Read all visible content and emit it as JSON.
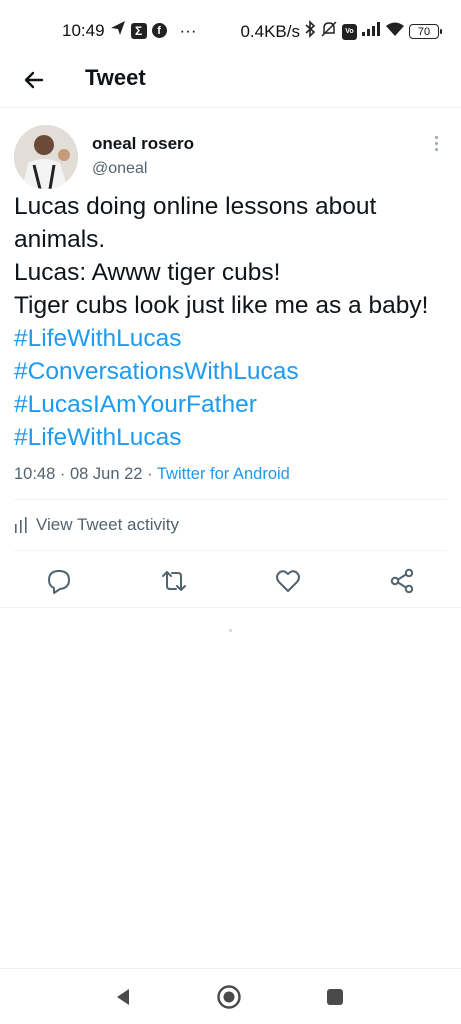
{
  "status_bar": {
    "time": "10:49",
    "left_icons": [
      "send-icon",
      "sigma-icon",
      "facebook-icon"
    ],
    "overflow": "···",
    "network_speed": "0.4KB/s",
    "right_icons": [
      "bluetooth-icon",
      "mute-icon",
      "volte-icon",
      "signal-icon",
      "wifi-icon"
    ],
    "battery": "70"
  },
  "header": {
    "back_icon": "arrow-left-icon",
    "title": "Tweet"
  },
  "tweet": {
    "author_name": "oneal rosero",
    "author_handle": "@oneal",
    "lines": [
      {
        "text": "Lucas doing online lessons about",
        "hashtag": false
      },
      {
        "text": "animals.",
        "hashtag": false
      },
      {
        "text": "Lucas: Awww tiger cubs!",
        "hashtag": false
      },
      {
        "text": "Tiger cubs look just like me as a baby!",
        "hashtag": false
      },
      {
        "text": "#LifeWithLucas",
        "hashtag": true
      },
      {
        "text": "#ConversationsWithLucas",
        "hashtag": true
      },
      {
        "text": "#LucasIAmYourFather",
        "hashtag": true
      },
      {
        "text": "#LifeWithLucas",
        "hashtag": true
      }
    ],
    "time": "10:48",
    "separator": "·",
    "date": "08 Jun 22",
    "source": "Twitter for Android",
    "activity_label": "View Tweet activity"
  },
  "actions": [
    "reply-icon",
    "retweet-icon",
    "like-icon",
    "share-icon"
  ],
  "nav": [
    "back-triangle-icon",
    "home-circle-icon",
    "recents-square-icon"
  ],
  "colors": {
    "accent": "#1d9bf0",
    "text": "#0f1419",
    "secondary": "#536471"
  }
}
